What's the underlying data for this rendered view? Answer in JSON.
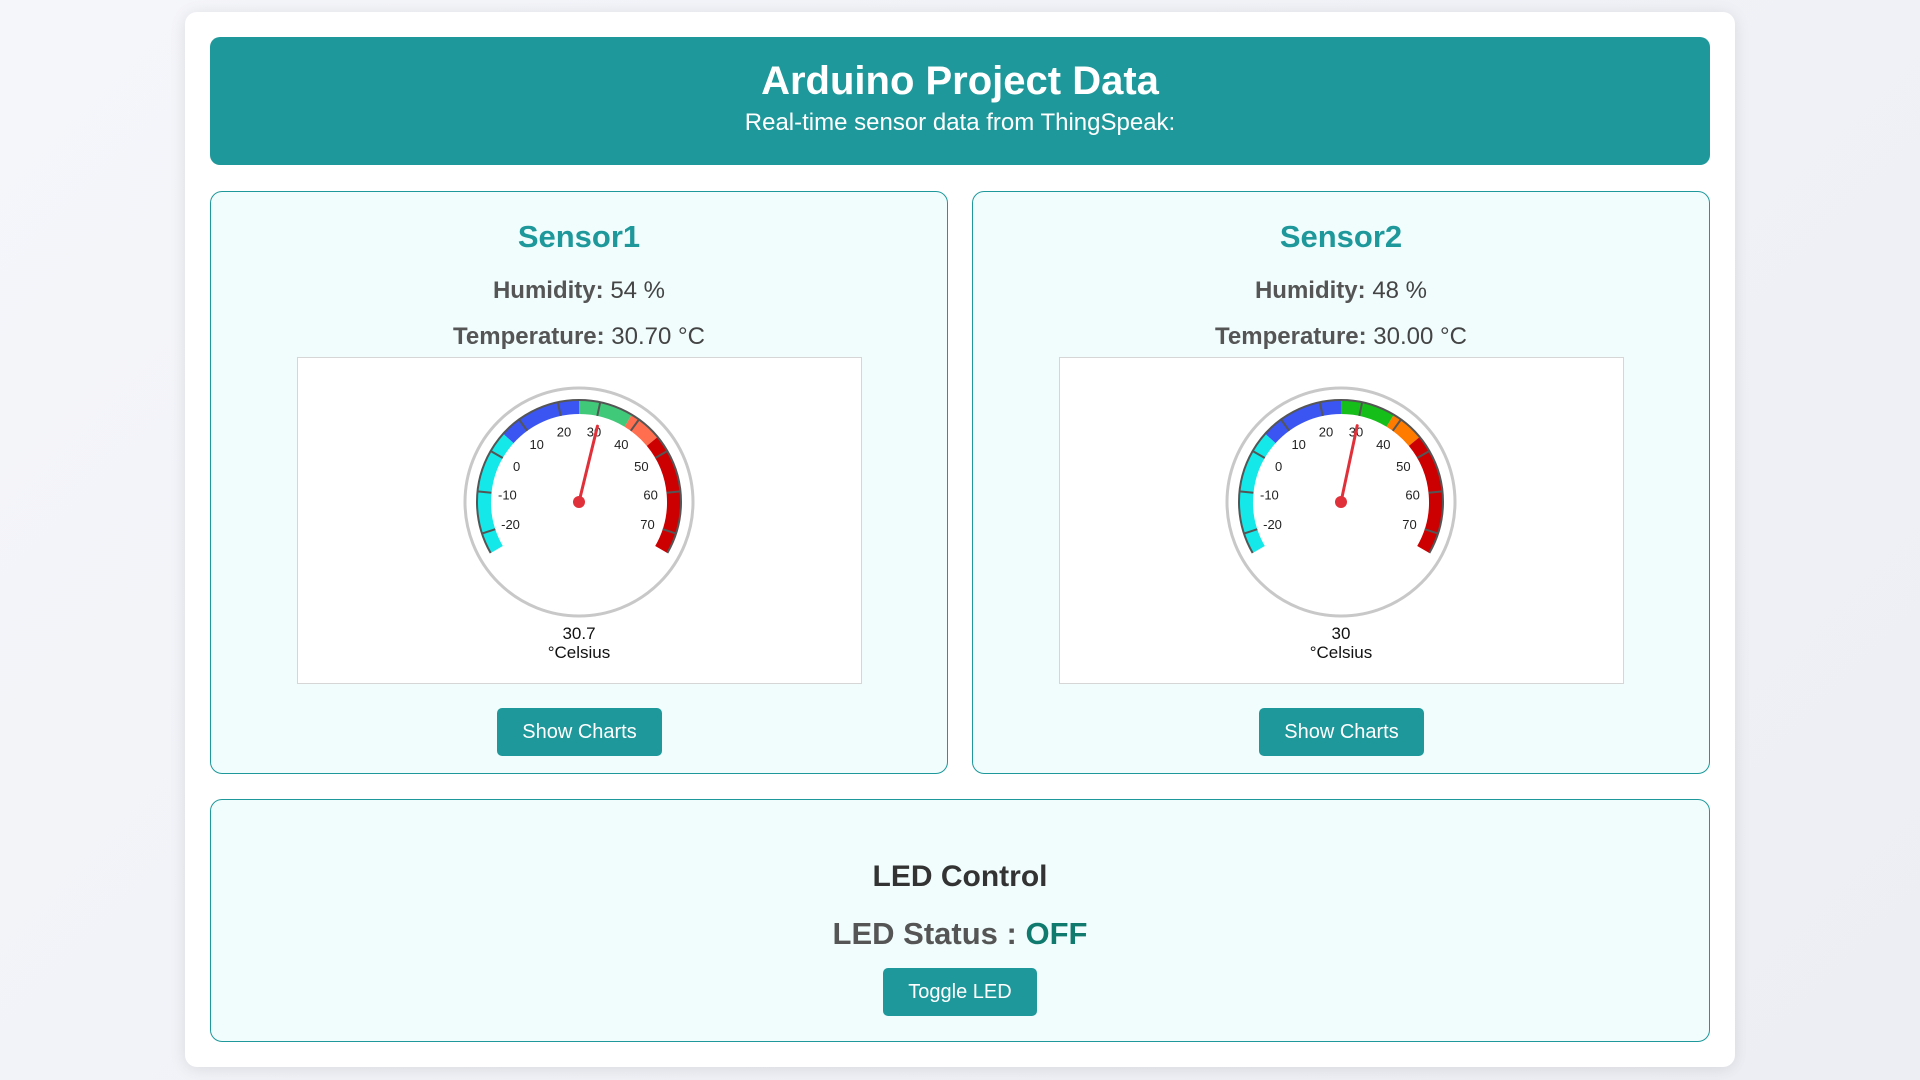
{
  "header": {
    "title": "Arduino Project Data",
    "subtitle": "Real-time sensor data from ThingSpeak:"
  },
  "sensors": [
    {
      "name": "Sensor1",
      "humidity_label": "Humidity:",
      "humidity_value": "54 %",
      "temperature_label": "Temperature:",
      "temperature_value": "30.70 °C",
      "gauge": {
        "value": 30.7,
        "value_text": "30.7",
        "unit": "°Celsius",
        "min": -25,
        "max": 75,
        "ticks": [
          "-20",
          "-10",
          "0",
          "10",
          "20",
          "30",
          "40",
          "50",
          "60",
          "70"
        ],
        "bands": [
          {
            "from": -25,
            "to": 5,
            "color": "#14e8e8"
          },
          {
            "from": 5,
            "to": 25,
            "color": "#3a55f2"
          },
          {
            "from": 25,
            "to": 38,
            "color": "#41c97a"
          },
          {
            "from": 38,
            "to": 46,
            "color": "#ff6e4e"
          },
          {
            "from": 46,
            "to": 75,
            "color": "#cc0000"
          }
        ]
      },
      "button": "Show Charts"
    },
    {
      "name": "Sensor2",
      "humidity_label": "Humidity:",
      "humidity_value": "48 %",
      "temperature_label": "Temperature:",
      "temperature_value": "30.00 °C",
      "gauge": {
        "value": 30,
        "value_text": "30",
        "unit": "°Celsius",
        "min": -25,
        "max": 75,
        "ticks": [
          "-20",
          "-10",
          "0",
          "10",
          "20",
          "30",
          "40",
          "50",
          "60",
          "70"
        ],
        "bands": [
          {
            "from": -25,
            "to": 5,
            "color": "#14e8e8"
          },
          {
            "from": 5,
            "to": 25,
            "color": "#3a55f2"
          },
          {
            "from": 25,
            "to": 38,
            "color": "#16be1a"
          },
          {
            "from": 38,
            "to": 46,
            "color": "#ff7b00"
          },
          {
            "from": 46,
            "to": 75,
            "color": "#cc0000"
          }
        ]
      },
      "button": "Show Charts"
    }
  ],
  "led": {
    "title": "LED Control",
    "status_label": "LED Status :",
    "status_value": "OFF",
    "button": "Toggle LED"
  },
  "colors": {
    "accent": "#1e989a",
    "status_off": "#117a6f",
    "needle": "#e0303a"
  }
}
